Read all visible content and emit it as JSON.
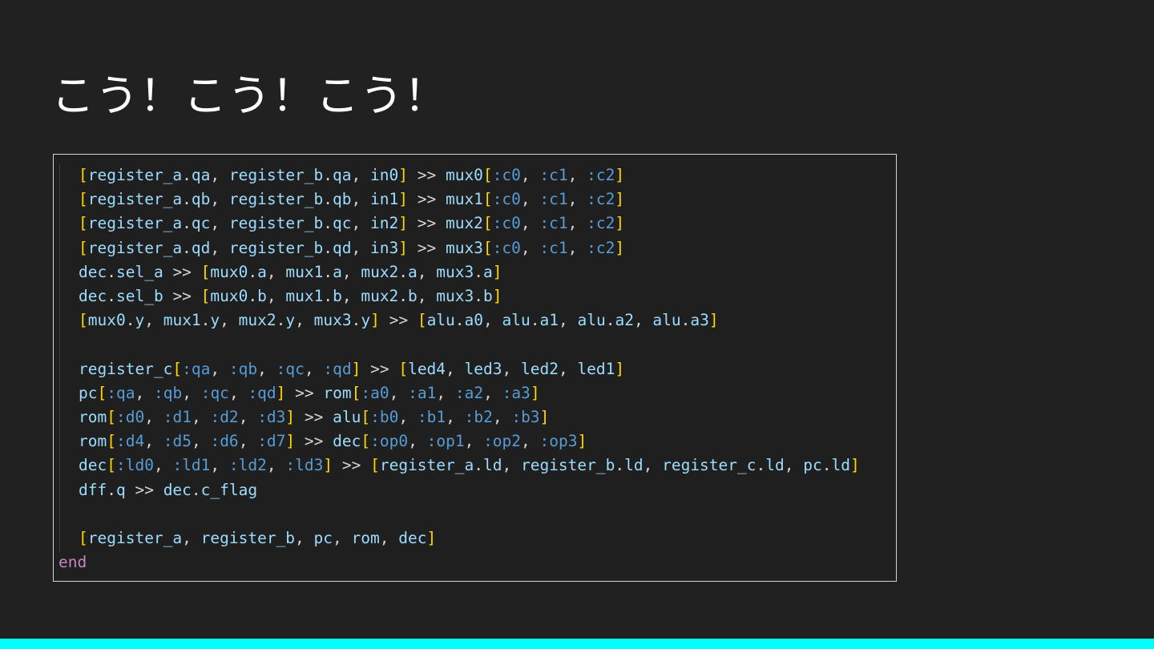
{
  "slide": {
    "title": "こう！こう！こう！",
    "accent_bar_color": "#00ffff",
    "background_color": "#212121"
  },
  "code": {
    "language": "ruby",
    "lines": [
      "  [register_a.qa, register_b.qa, in0] >> mux0[:c0, :c1, :c2]",
      "  [register_a.qb, register_b.qb, in1] >> mux1[:c0, :c1, :c2]",
      "  [register_a.qc, register_b.qc, in2] >> mux2[:c0, :c1, :c2]",
      "  [register_a.qd, register_b.qd, in3] >> mux3[:c0, :c1, :c2]",
      "  dec.sel_a >> [mux0.a, mux1.a, mux2.a, mux3.a]",
      "  dec.sel_b >> [mux0.b, mux1.b, mux2.b, mux3.b]",
      "  [mux0.y, mux1.y, mux2.y, mux3.y] >> [alu.a0, alu.a1, alu.a2, alu.a3]",
      "",
      "  register_c[:qa, :qb, :qc, :qd] >> [led4, led3, led2, led1]",
      "  pc[:qa, :qb, :qc, :qd] >> rom[:a0, :a1, :a2, :a3]",
      "  rom[:d0, :d1, :d2, :d3] >> alu[:b0, :b1, :b2, :b3]",
      "  rom[:d4, :d5, :d6, :d7] >> dec[:op0, :op1, :op2, :op3]",
      "  dec[:ld0, :ld1, :ld2, :ld3] >> [register_a.ld, register_b.ld, register_c.ld, pc.ld]",
      "  dff.q >> dec.c_flag",
      "",
      "  [register_a, register_b, pc, rom, dec]",
      "end"
    ],
    "colors": {
      "identifier": "#9cdcfe",
      "bracket": "#ffd700",
      "symbol": "#569cd6",
      "operator": "#d4d4d4",
      "keyword": "#c586c0"
    }
  }
}
